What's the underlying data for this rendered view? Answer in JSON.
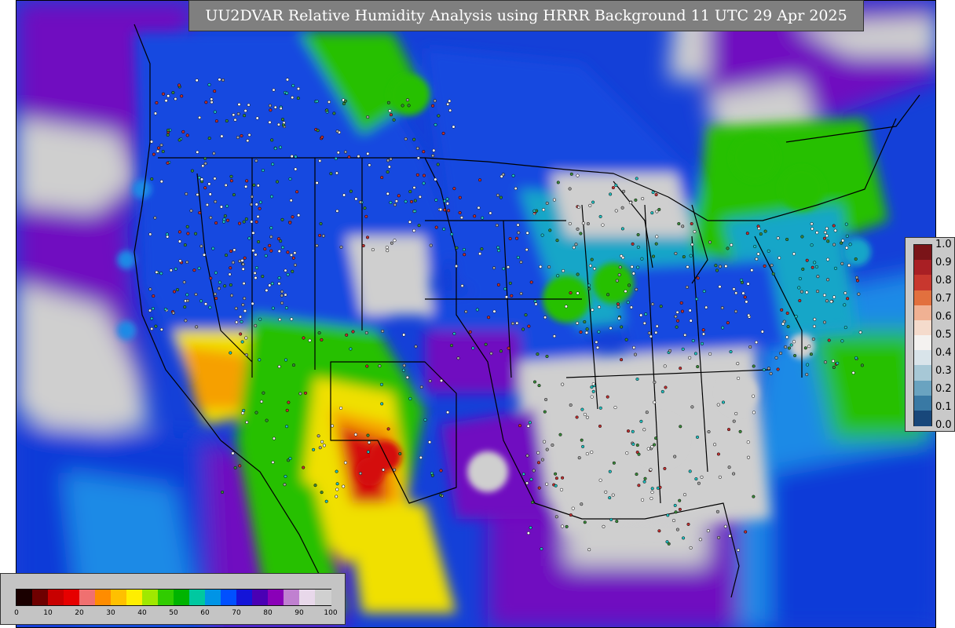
{
  "title": "UU2DVAR Relative Humidity Analysis using HRRR Background 11 UTC 29 Apr 2025",
  "weight_legend": {
    "labels": [
      "1.0",
      "0.9",
      "0.8",
      "0.7",
      "0.6",
      "0.5",
      "0.4",
      "0.3",
      "0.2",
      "0.1",
      "0.0"
    ],
    "colors": [
      "#7a1418",
      "#a91f24",
      "#c8372e",
      "#e2703e",
      "#f0b193",
      "#f5dbcc",
      "#f4f2f0",
      "#d9e4ea",
      "#a7c8d6",
      "#6aa3c0",
      "#3979a4",
      "#18477a"
    ]
  },
  "rh_legend": {
    "labels": [
      "0",
      "10",
      "20",
      "30",
      "40",
      "50",
      "60",
      "70",
      "80",
      "90",
      "100"
    ],
    "colors": [
      "#1a0000",
      "#6e0000",
      "#c80000",
      "#e60000",
      "#f07070",
      "#ff8c00",
      "#ffc000",
      "#ffee00",
      "#a0e800",
      "#30cc00",
      "#00b400",
      "#00c8a0",
      "#0094e6",
      "#0050ff",
      "#1414d8",
      "#4a00b4",
      "#8a00b8",
      "#c080d0",
      "#e8d8ea",
      "#d0d0d0"
    ]
  },
  "map_colors": {
    "ocean_deep": "#0a3ad8",
    "ocean_mid": "#1e8ae6",
    "ocean_light": "#2fc0d8",
    "humid_purple": "#7010c0",
    "saturated_gray": "#cfcfcf",
    "dry_red": "#d41010",
    "dry_orange": "#f6a000",
    "dry_yellow": "#f0e000",
    "moist_green": "#28c000",
    "land_blue": "#1448e0",
    "land_teal": "#18a6c8"
  }
}
